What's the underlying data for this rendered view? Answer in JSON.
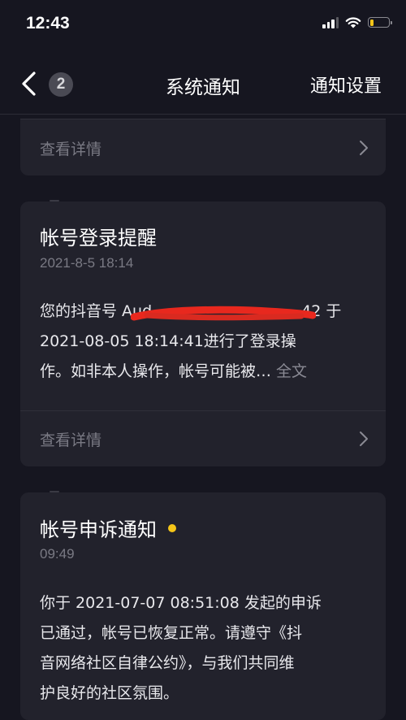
{
  "status_bar": {
    "time": "12:43",
    "battery_level": 0.2,
    "battery_color": "#f5c518"
  },
  "nav": {
    "back_icon": "chevron-left-icon",
    "badge_count": "2",
    "title": "系统通知",
    "settings_label": "通知设置"
  },
  "cards": [
    {
      "detail_label": "查看详情"
    },
    {
      "title": "帐号登录提醒",
      "time": "2021-8-5 18:14",
      "body_lines": [
        "您的抖音号 Aud",
        "42 于",
        "2021-08-05 18:14:41进行了登录操",
        "作。如非本人操作，帐号可能被…"
      ],
      "full_text_label": "全文",
      "detail_label": "查看详情"
    },
    {
      "title": "帐号申诉通知",
      "unread": true,
      "time": "09:49",
      "body_lines": [
        "你于 2021-07-07 08:51:08 发起的申诉",
        "已通过，帐号已恢复正常。请遵守《抖",
        "音网络社区自律公约》，与我们共同维",
        "护良好的社区氛围。"
      ]
    }
  ],
  "colors": {
    "background": "#161620",
    "card": "#22222c",
    "accent_dot": "#f5c518",
    "redaction": "#e8281e"
  }
}
